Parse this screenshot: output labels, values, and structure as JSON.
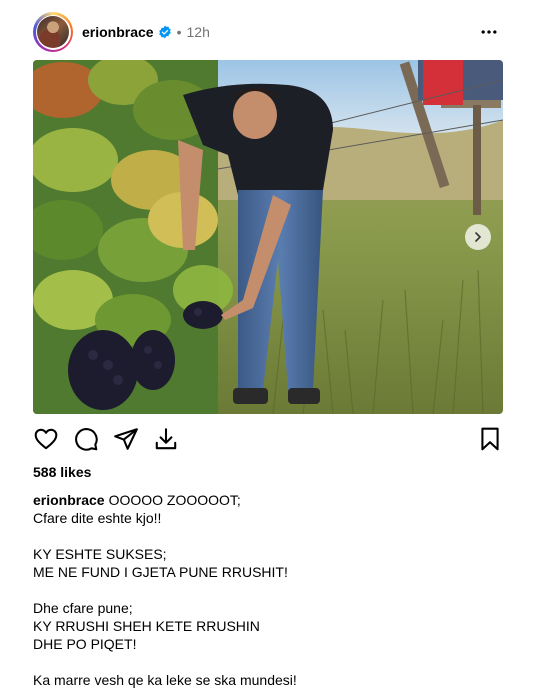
{
  "post": {
    "username": "erionbrace",
    "time": "12h",
    "dot": "•"
  },
  "likes": "588 likes",
  "caption": {
    "username": "erionbrace",
    "lines": [
      "OOOOO ZOOOOOT;",
      "Cfare dite eshte kjo!!",
      "",
      "KY ESHTE SUKSES;",
      "ME NE FUND I GJETA PUNE RRUSHIT!",
      "",
      "Dhe cfare pune;",
      "KY RRUSHI SHEH KETE RRUSHIN",
      "DHE PO PIQET!",
      "",
      "Ka marre vesh qe ka leke se ska mundesi!"
    ]
  },
  "icons": {
    "more": "more-options-icon",
    "verified": "verified-badge-icon",
    "like": "heart-icon",
    "comment": "comment-icon",
    "share": "send-icon",
    "save_download": "download-icon",
    "bookmark": "bookmark-icon",
    "next": "chevron-right-icon"
  },
  "colors": {
    "verified": "#0095f6",
    "muted": "#737373"
  }
}
